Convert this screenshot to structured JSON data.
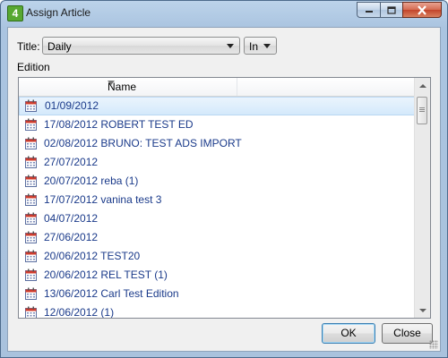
{
  "window": {
    "title": "Assign Article",
    "icon_glyph": "4",
    "accent_color": "#58a832"
  },
  "form": {
    "title_label": "Title:",
    "title_value": "Daily",
    "mode_value": "In",
    "edition_label": "Edition"
  },
  "list": {
    "column_name": "Name",
    "items": [
      "01/09/2012",
      "17/08/2012 ROBERT TEST ED",
      "02/08/2012 BRUNO: TEST ADS IMPORT",
      "27/07/2012",
      "20/07/2012 reba (1)",
      "17/07/2012 vanina test 3",
      "04/07/2012",
      "27/06/2012",
      "20/06/2012 TEST20",
      "20/06/2012 REL TEST (1)",
      "13/06/2012 Carl Test Edition",
      "12/06/2012 (1)"
    ],
    "selected_index": 0,
    "item_icon": "calendar-icon"
  },
  "buttons": {
    "ok": "OK",
    "close": "Close"
  }
}
